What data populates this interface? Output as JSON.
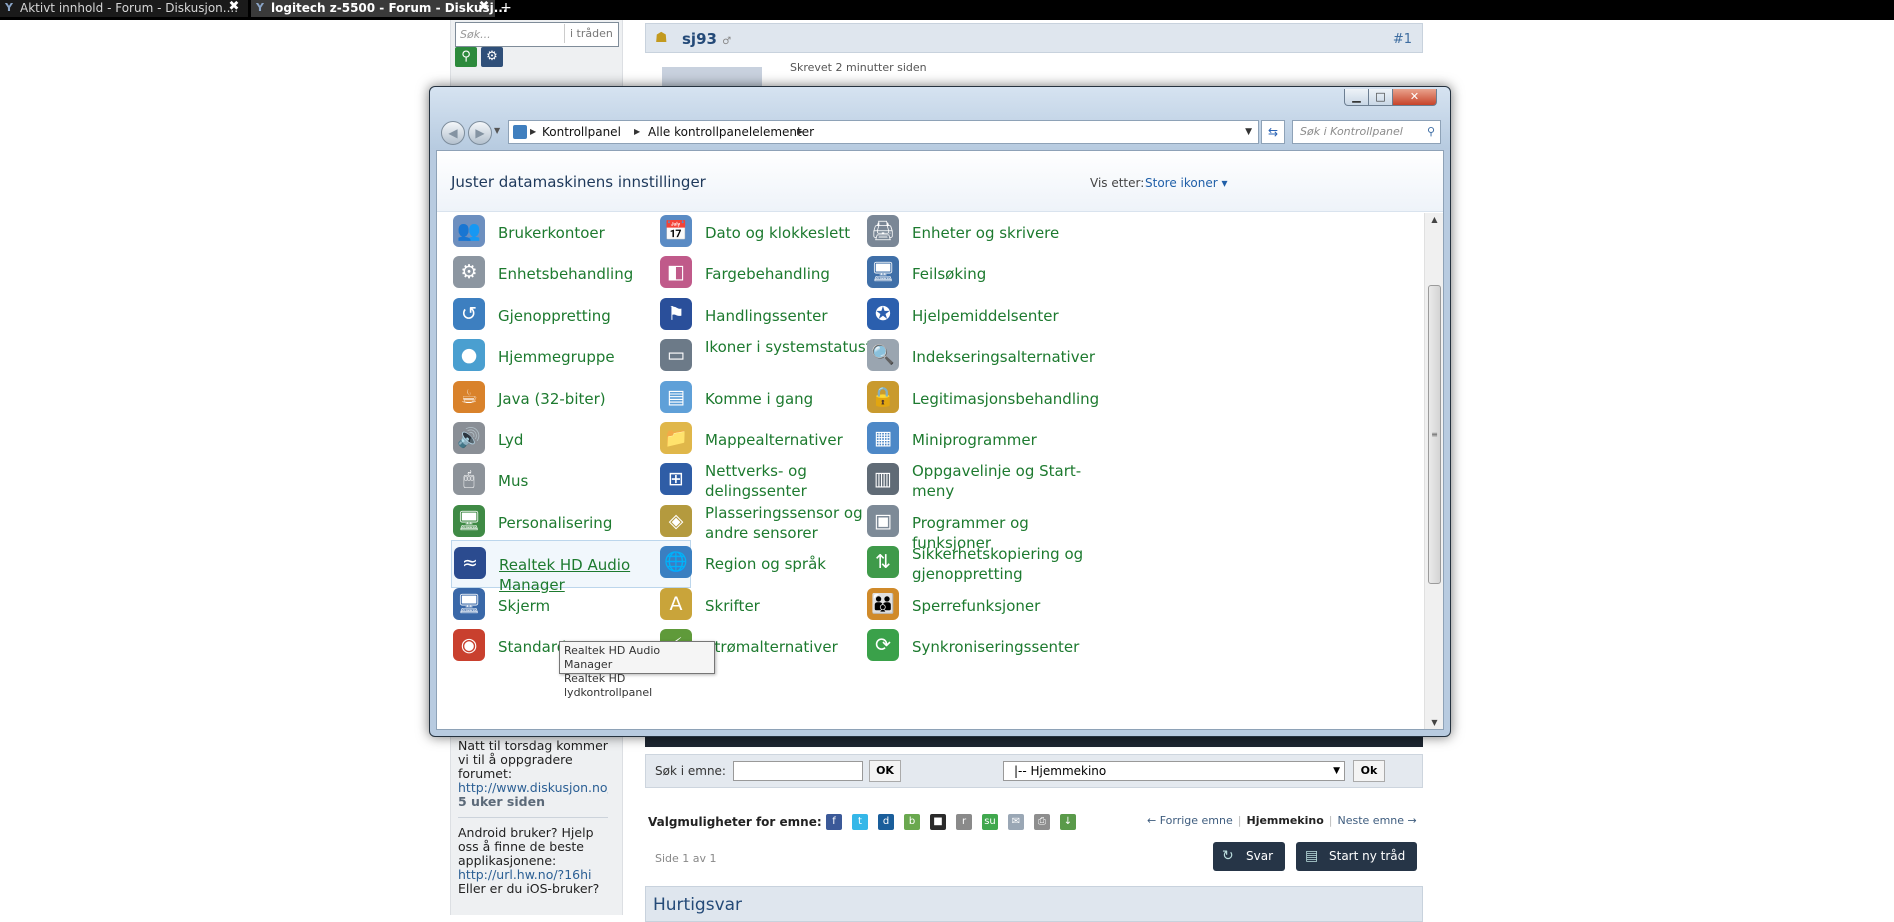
{
  "browser": {
    "tabs": [
      {
        "label": "Aktivt innhold - Forum - Diskusjon....",
        "favicon": "Y",
        "active": false
      },
      {
        "label": "logitech z-5500 - Forum - Diskusj...",
        "favicon": "Y",
        "active": true
      }
    ],
    "new_tab": "+",
    "close_glyph": "✖"
  },
  "forum": {
    "search": {
      "placeholder": "Søk...",
      "scope": "i tråden"
    },
    "search_go_icon": "search-icon",
    "search_options_icon": "gear-icon",
    "post": {
      "author": "sj93",
      "author_status": "♂",
      "number": "#1",
      "meta": "Skrevet 2 minutter siden"
    },
    "topic_search": {
      "label": "Søk i emne:",
      "ok": "OK",
      "forum_select": "|-- Hjemmekino",
      "ok2": "Ok"
    },
    "topic_options": {
      "label": "Valgmuligheter for emne:",
      "share_icons": [
        {
          "name": "facebook-icon",
          "glyph": "f",
          "color": "#3b5998"
        },
        {
          "name": "twitter-icon",
          "glyph": "t",
          "color": "#35b7e8"
        },
        {
          "name": "digg-icon",
          "glyph": "d",
          "color": "#1a5e9b"
        },
        {
          "name": "buzz-icon",
          "glyph": "b",
          "color": "#6aa84f"
        },
        {
          "name": "delicious-icon",
          "glyph": "■",
          "color": "#2b2b2b"
        },
        {
          "name": "reddit-icon",
          "glyph": "r",
          "color": "#8a8a8a"
        },
        {
          "name": "stumbleupon-icon",
          "glyph": "su",
          "color": "#40a84e"
        },
        {
          "name": "email-icon",
          "glyph": "✉",
          "color": "#9aa7b5"
        },
        {
          "name": "print-icon",
          "glyph": "⎙",
          "color": "#8e8e8e"
        },
        {
          "name": "download-icon",
          "glyph": "↓",
          "color": "#5a9a4a"
        }
      ]
    },
    "topic_nav": {
      "prev": "← Forrige emne",
      "current": "Hjemmekino",
      "next": "Neste emne →"
    },
    "page_info": "Side 1 av 1",
    "reply_button": "Svar",
    "new_topic_button": "Start ny tråd",
    "quick_reply": "Hurtigsvar",
    "news": [
      {
        "text": "Natt til torsdag kommer vi til å oppgradere forumet:",
        "link": "http://www.diskusjon.no/index.php?showforum",
        "ago": "5 uker siden"
      },
      {
        "text": "Android bruker? Hjelp oss å finne de beste applikasjonene:",
        "link": "http://url.hw.no/?16hi",
        "more": "Eller er du iOS-bruker?"
      }
    ]
  },
  "control_panel": {
    "breadcrumb": [
      "Kontrollpanel",
      "Alle kontrollpanelelementer"
    ],
    "search_placeholder": "Søk i Kontrollpanel",
    "title": "Juster datamaskinens innstillinger",
    "view_by_label": "Vis etter:",
    "view_by_value": "Store ikoner ▾",
    "items": [
      {
        "label": "Brukerkontoer",
        "icon": "user-accounts-icon",
        "glyph": "👥",
        "color": "#6d8fbf"
      },
      {
        "label": "Dato og klokkeslett",
        "icon": "date-time-icon",
        "glyph": "📅",
        "color": "#5a8bc4"
      },
      {
        "label": "Enheter og skrivere",
        "icon": "devices-printers-icon",
        "glyph": "🖨",
        "color": "#7a8796"
      },
      {
        "label": "Enhetsbehandling",
        "icon": "device-manager-icon",
        "glyph": "⚙",
        "color": "#8c96a1"
      },
      {
        "label": "Fargebehandling",
        "icon": "color-management-icon",
        "glyph": "◧",
        "color": "#c05a8a"
      },
      {
        "label": "Feilsøking",
        "icon": "troubleshooting-icon",
        "glyph": "🖥",
        "color": "#3f6fa8"
      },
      {
        "label": "Gjenoppretting",
        "icon": "recovery-icon",
        "glyph": "↺",
        "color": "#3d7fc0"
      },
      {
        "label": "Handlingssenter",
        "icon": "action-center-icon",
        "glyph": "⚑",
        "color": "#2a4f9a"
      },
      {
        "label": "Hjelpemiddelsenter",
        "icon": "ease-of-access-icon",
        "glyph": "✪",
        "color": "#2b5fae"
      },
      {
        "label": "Hjemmegruppe",
        "icon": "homegroup-icon",
        "glyph": "●",
        "color": "#4a9fd0"
      },
      {
        "label": "Ikoner i systemstatusfelt",
        "icon": "notification-area-icon",
        "glyph": "▭",
        "color": "#6c7a88"
      },
      {
        "label": "Indekseringsalternativer",
        "icon": "indexing-options-icon",
        "glyph": "🔍",
        "color": "#9aa5b0"
      },
      {
        "label": "Java (32-biter)",
        "icon": "java-icon",
        "glyph": "☕",
        "color": "#d9822b"
      },
      {
        "label": "Komme i gang",
        "icon": "getting-started-icon",
        "glyph": "▤",
        "color": "#5fa0d8"
      },
      {
        "label": "Legitimasjonsbehandling",
        "icon": "credential-manager-icon",
        "glyph": "🔒",
        "color": "#c99a2e"
      },
      {
        "label": "Lyd",
        "icon": "sound-icon",
        "glyph": "🔊",
        "color": "#8a8f96"
      },
      {
        "label": "Mappealternativer",
        "icon": "folder-options-icon",
        "glyph": "📁",
        "color": "#e0b74a"
      },
      {
        "label": "Miniprogrammer",
        "icon": "gadgets-icon",
        "glyph": "▦",
        "color": "#4d88c7"
      },
      {
        "label": "Mus",
        "icon": "mouse-icon",
        "glyph": "🖱",
        "color": "#8d939a"
      },
      {
        "label": "Nettverks- og delingssenter",
        "icon": "network-sharing-icon",
        "glyph": "⊞",
        "color": "#2f5da6"
      },
      {
        "label": "Oppgavelinje og Start-meny",
        "icon": "taskbar-icon",
        "glyph": "▥",
        "color": "#606b76"
      },
      {
        "label": "Personalisering",
        "icon": "personalization-icon",
        "glyph": "🖥",
        "color": "#3f8a45"
      },
      {
        "label": "Plasseringssensor og andre sensorer",
        "icon": "location-sensor-icon",
        "glyph": "◈",
        "color": "#b49a3e"
      },
      {
        "label": "Programmer og funksjoner",
        "icon": "programs-features-icon",
        "glyph": "▣",
        "color": "#7d8a97"
      },
      {
        "label": "Realtek HD Audio Manager",
        "icon": "realtek-audio-icon",
        "glyph": "≈",
        "color": "#2b4b8f"
      },
      {
        "label": "Region og språk",
        "icon": "region-language-icon",
        "glyph": "🌐",
        "color": "#3a7fc1"
      },
      {
        "label": "Sikkerhetskopiering og gjenoppretting",
        "icon": "backup-restore-icon",
        "glyph": "⇅",
        "color": "#3f9a4a"
      },
      {
        "label": "Skjerm",
        "icon": "display-icon",
        "glyph": "🖥",
        "color": "#3a68a8"
      },
      {
        "label": "Skrifter",
        "icon": "fonts-icon",
        "glyph": "A",
        "color": "#c9a43a"
      },
      {
        "label": "Sperrefunksjoner",
        "icon": "parental-controls-icon",
        "glyph": "👪",
        "color": "#d08a2a"
      },
      {
        "label": "Standardprogrammer",
        "icon": "default-programs-icon",
        "glyph": "◉",
        "color": "#c9402e"
      },
      {
        "label": "Strømalternativer",
        "icon": "power-options-icon",
        "glyph": "⚡",
        "color": "#5f9a3a"
      },
      {
        "label": "Synkroniseringssenter",
        "icon": "sync-center-icon",
        "glyph": "⟳",
        "color": "#3aa14a"
      }
    ],
    "tooltip": {
      "line1": "Realtek HD Audio Manager",
      "line2": "Realtek HD lydkontrollpanel"
    }
  }
}
